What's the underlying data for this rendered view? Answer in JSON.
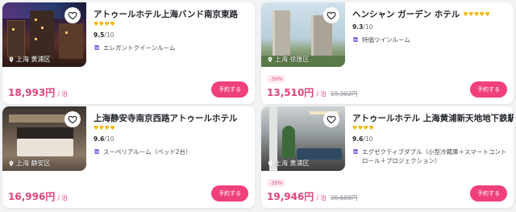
{
  "colors": {
    "accent": "#f0407a",
    "price": "#e0447a",
    "star": "#f5b400"
  },
  "hotels": [
    {
      "name": "アトゥールホテル上海バンド南京東路",
      "stars": "♥♥♥♥",
      "score": "9.5",
      "score_suffix": "/10",
      "room": "エレガントクイーンルーム",
      "location": "上海 黄浦区",
      "price": "18,993円",
      "per": "/ 泊",
      "book_label": "予約する"
    },
    {
      "name": "ヘンシャン ガーデン ホテル",
      "stars": "♥♥♥♥♥",
      "score": "9.3",
      "score_suffix": "/10",
      "room": "特価ツインルーム",
      "location": "上海 徐匯区",
      "discount": "-30%",
      "price": "13,510円",
      "per": "/ 泊",
      "original_price": "19,302円",
      "book_label": "予約する"
    },
    {
      "name": "上海静安寺南京西路アトゥールホテル",
      "stars": "♥♥♥♥",
      "score": "9.6",
      "score_suffix": "/10",
      "room": "スーペリアルーム（ベッド2台）",
      "location": "上海 静安区",
      "price": "16,996円",
      "per": "/ 泊",
      "book_label": "予約する"
    },
    {
      "name": "アトゥールホテル 上海黄浦新天地地下鉄駅",
      "stars": "♥♥♥♥",
      "score": "9.6",
      "score_suffix": "/10",
      "room": "エグゼクティブダブル（小型冷蔵庫＋スマートコントロール＋プロジェクション）",
      "location": "上海 黄浦区",
      "discount": "-35%",
      "price": "19,946円",
      "per": "/ 泊",
      "original_price": "30,688円",
      "book_label": "予約する"
    }
  ],
  "icons": {
    "favorite": "heart-outline-icon",
    "location": "location-pin-icon",
    "room": "bed-icon"
  }
}
